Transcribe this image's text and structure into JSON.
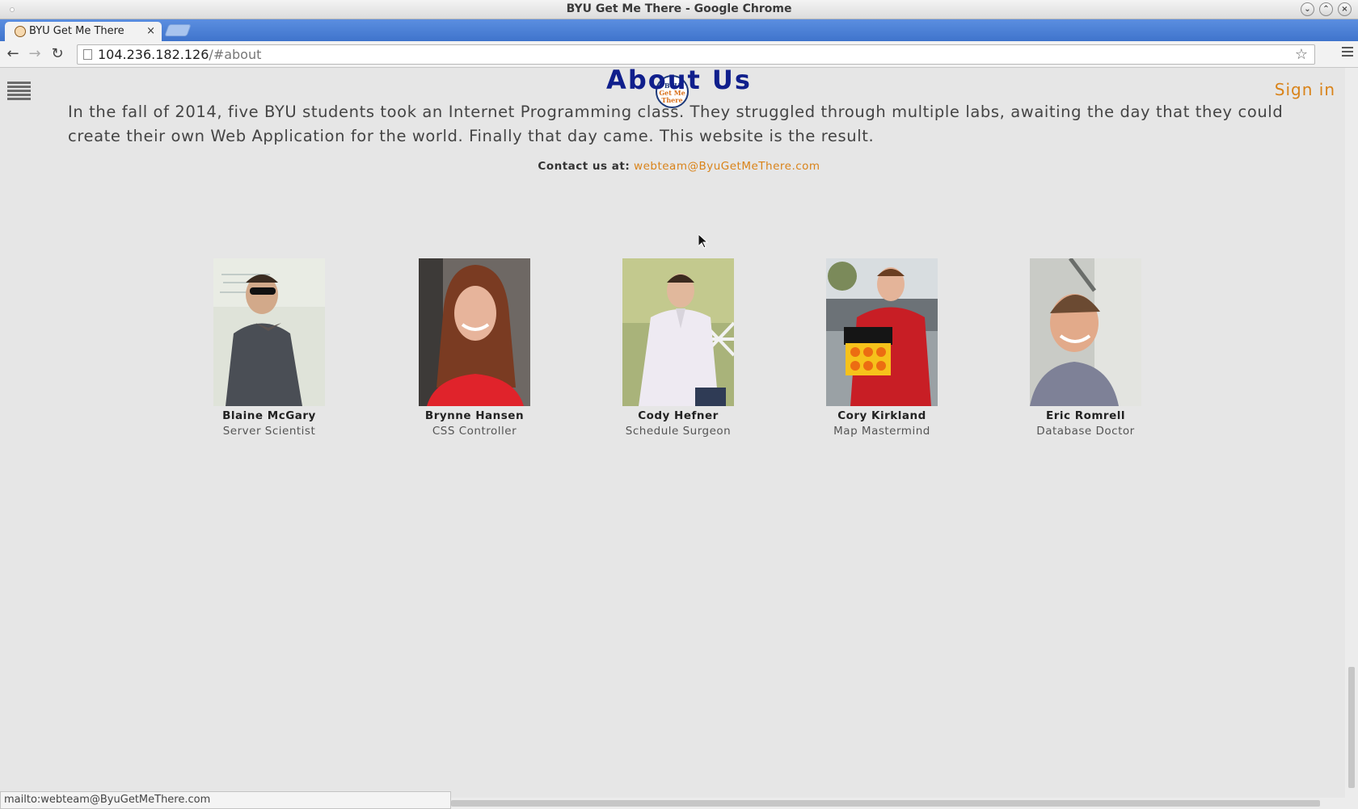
{
  "window": {
    "title": "BYU Get Me There - Google Chrome"
  },
  "browser": {
    "tab_title": "BYU Get Me There",
    "tab_close": "×",
    "url_host": "104.236.182.126",
    "url_path": "/#about",
    "back": "←",
    "forward": "→",
    "reload": "↻",
    "star": "☆"
  },
  "header": {
    "logo_text_top": "BYU",
    "logo_text_mid": "Get Me",
    "logo_text_bottom": "There",
    "signin_label": "Sign in"
  },
  "about": {
    "title": "About Us",
    "intro": "In the fall of 2014, five BYU students took an Internet Programming class. They struggled through multiple labs, awaiting the day that they could create their own Web Application for the world. Finally that day came. This website is the result.",
    "contact_label": "Contact us at:",
    "contact_email": "webteam@ByuGetMeThere.com"
  },
  "team": [
    {
      "name": "Blaine McGary",
      "role": "Server Scientist"
    },
    {
      "name": "Brynne Hansen",
      "role": "CSS Controller"
    },
    {
      "name": "Cody Hefner",
      "role": "Schedule Surgeon"
    },
    {
      "name": "Cory Kirkland",
      "role": "Map Mastermind"
    },
    {
      "name": "Eric Romrell",
      "role": "Database Doctor"
    }
  ],
  "status_bar": {
    "text": "mailto:webteam@ByuGetMeThere.com"
  },
  "colors": {
    "accent": "#d98319",
    "heading": "#101f8c",
    "background": "#e6e6e6"
  }
}
